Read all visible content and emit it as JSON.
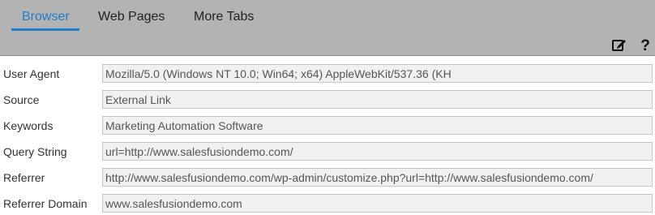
{
  "tabs": [
    {
      "label": "Browser",
      "active": true
    },
    {
      "label": "Web Pages",
      "active": false
    },
    {
      "label": "More Tabs",
      "active": false
    }
  ],
  "toolbar": {
    "icons": [
      "edit-icon",
      "help-icon"
    ]
  },
  "colors": {
    "accent": "#1f7ec9",
    "header_background": "#b3b3b3",
    "field_background": "#f1f1f1"
  },
  "fields": [
    {
      "label": "User Agent",
      "value": "Mozilla/5.0 (Windows NT 10.0; Win64; x64) AppleWebKit/537.36 (KH"
    },
    {
      "label": "Source",
      "value": "External Link"
    },
    {
      "label": "Keywords",
      "value": "Marketing Automation Software"
    },
    {
      "label": "Query String",
      "value": "url=http://www.salesfusiondemo.com/"
    },
    {
      "label": "Referrer",
      "value": "http://www.salesfusiondemo.com/wp-admin/customize.php?url=http://www.salesfusiondemo.com/"
    },
    {
      "label": "Referrer Domain",
      "value": "www.salesfusiondemo.com"
    }
  ]
}
